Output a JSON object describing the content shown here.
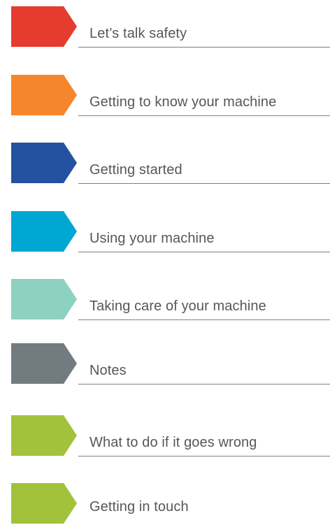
{
  "sections": [
    {
      "label": "Let’s talk safety",
      "color": "#e63c2f",
      "icon": "section-tab-icon"
    },
    {
      "label": "Getting to know your machine",
      "color": "#f5862b",
      "icon": "section-tab-icon"
    },
    {
      "label": "Getting started",
      "color": "#2452a0",
      "icon": "section-tab-icon"
    },
    {
      "label": "Using your machine",
      "color": "#00a7d3",
      "icon": "section-tab-icon"
    },
    {
      "label": "Taking care of your machine",
      "color": "#8dd1c1",
      "icon": "section-tab-icon"
    },
    {
      "label": "Notes",
      "color": "#727b80",
      "icon": "section-tab-icon"
    },
    {
      "label": "What to do if it goes wrong",
      "color": "#a3c23c",
      "icon": "section-tab-icon"
    },
    {
      "label": "Getting in touch",
      "color": "#a3c23c",
      "icon": "section-tab-icon"
    }
  ]
}
